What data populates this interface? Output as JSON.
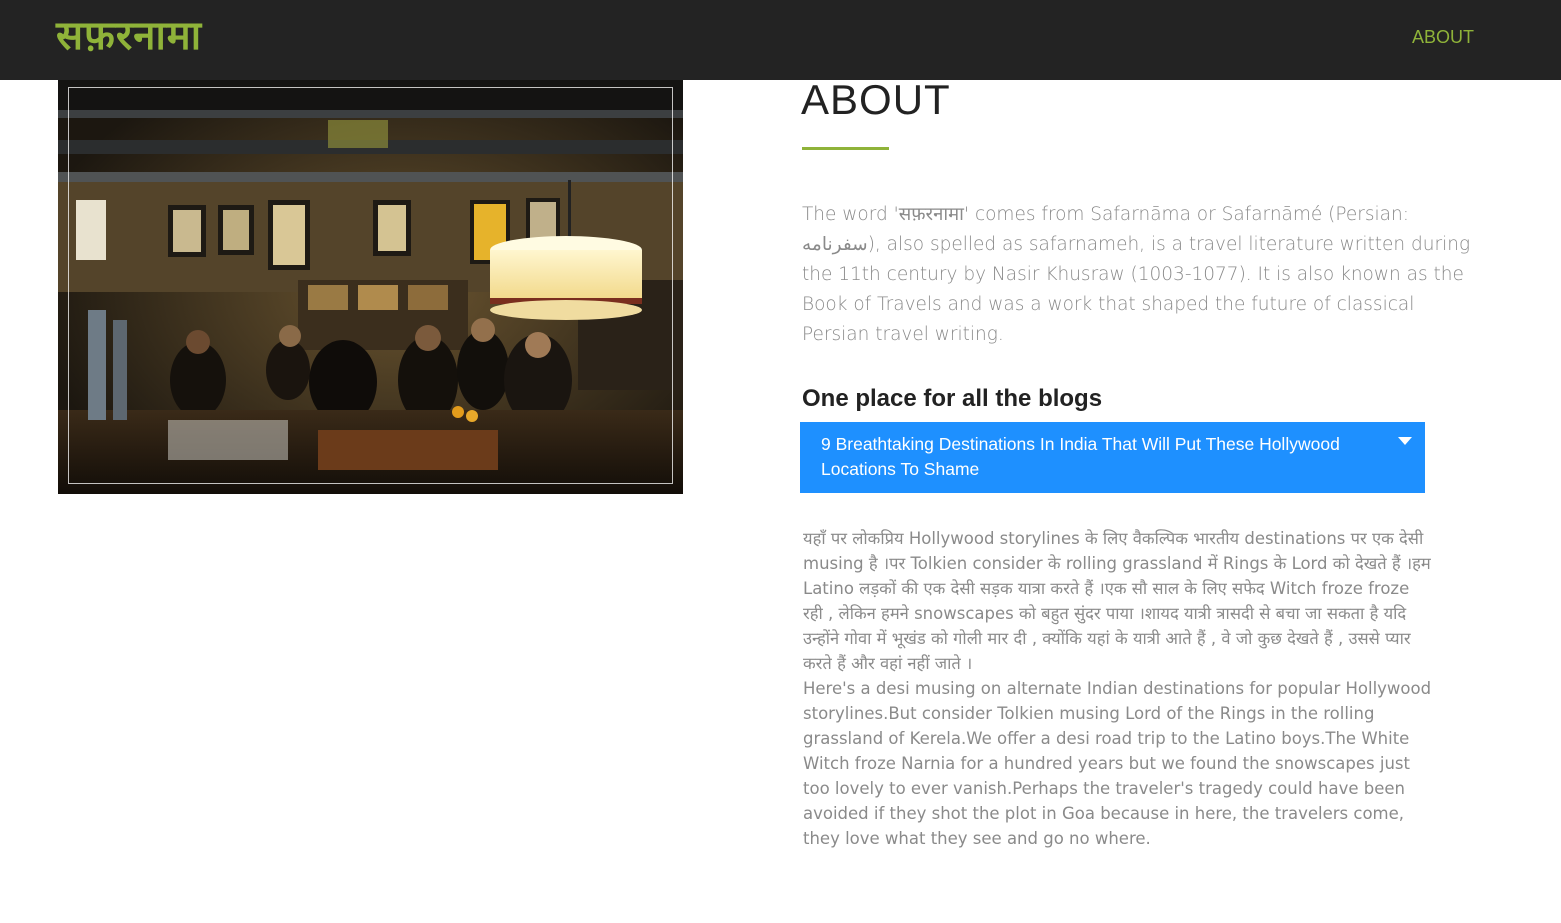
{
  "navbar": {
    "brand": "सफ़रनामा",
    "about_link": "ABOUT"
  },
  "colors": {
    "navbar_bg": "#232323",
    "accent_green": "#8fb339",
    "select_blue": "#1e90ff",
    "body_text": "#8a8a8a",
    "heading_text": "#222222"
  },
  "about": {
    "title": "ABOUT",
    "description": "The word 'सफ़रनामा' comes from Safarnāma or Safarnāmé (Persian: سفرنامه), also spelled as safarnameh, is a travel literature written during the 11th century by Nasir Khusraw (1003-1077). It is also known as the Book of Travels and was a work that shaped the future of classical Persian travel writing."
  },
  "blogs": {
    "heading": "One place for all the blogs",
    "selected_blog": "9 Breathtaking Destinations In India That Will Put These Hollywood Locations To Shame",
    "body_hindi": "यहाँ पर लोकप्रिय Hollywood storylines के लिए वैकल्पिक भारतीय destinations पर एक देसी musing है ।पर Tolkien consider के rolling grassland में Rings के Lord को देखते हैं ।हम Latino लड़कों की एक देसी सड़क यात्रा करते हैं ।एक सौ साल के लिए सफेद Witch froze froze रही , लेकिन हमने snowscapes को बहुत सुंदर पाया ।शायद यात्री त्रासदी से बचा जा सकता है यदि उन्होंने गोवा में भूखंड को गोली मार दी , क्योंकि यहां के यात्री आते हैं , वे जो कुछ देखते हैं , उससे प्यार करते हैं और वहां नहीं जाते ।",
    "body_english": "Here's a desi musing on alternate Indian destinations for popular Hollywood storylines.But consider Tolkien musing Lord of the Rings in the rolling grassland of Kerela.We offer a desi road trip to the Latino boys.The White Witch froze Narnia for a hundred years but we found the snowscapes just too lovely to ever vanish.Perhaps the traveler's tragedy could have been avoided if they shot the plot in Goa because in here, the travelers come, they love what they see and go no where."
  },
  "icons": {
    "select_caret": "caret-down-icon"
  }
}
